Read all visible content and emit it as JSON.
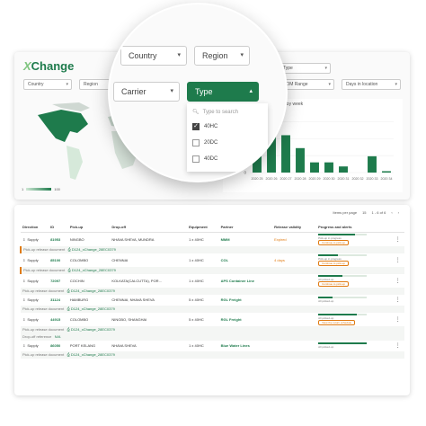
{
  "brand": {
    "x": "X",
    "name": "Change"
  },
  "filters_top_row": [
    "Type"
  ],
  "filters_row2": [
    "Country",
    "Region",
    "YOM Range",
    "Days in location"
  ],
  "magnifier": {
    "country": "Country",
    "region": "Region",
    "carrier": "Carrier",
    "type": "Type",
    "search_placeholder": "Type to search",
    "options": [
      {
        "label": "40HC",
        "checked": true
      },
      {
        "label": "20DC",
        "checked": false
      },
      {
        "label": "40DC",
        "checked": false
      }
    ]
  },
  "map": {
    "legend_min": "1",
    "legend_max": "100"
  },
  "chart_data": {
    "type": "bar",
    "title": "ainers arriving by week",
    "categories": [
      "2020 25",
      "2020 26",
      "2020 27",
      "2020 28",
      "2020 29",
      "2020 30",
      "2020 31",
      "2020 32",
      "2020 33",
      "2020 34"
    ],
    "values": [
      24,
      80,
      55,
      36,
      15,
      15,
      9,
      0,
      24,
      2
    ],
    "yticks": [
      "0",
      "25",
      "50",
      "75"
    ],
    "ylim": [
      0,
      90
    ],
    "color": "#1e7b4c"
  },
  "table": {
    "pager": {
      "items_label": "Items per page",
      "per_page": "15",
      "range": "1 - 6 of 6"
    },
    "columns": [
      "Direction",
      "ID",
      "Pick-up",
      "Drop-off",
      "Equipment",
      "Partner",
      "Release validity",
      "Progress and alerts"
    ],
    "rows": [
      {
        "dir": "Supply",
        "id": "81953",
        "pickup": "NINGBO",
        "dropoff": "NHAVA SHEVA, MUNDRA",
        "equip": "1 x 40HC",
        "partner": "MMM",
        "validity": "",
        "progress": 0.75,
        "ptxt": "Pick-up in progress",
        "sub": "Pick-up release document",
        "doc": "D124_xChange_28EC0379",
        "pill": "Continue to pick-up",
        "sub_validity": "Expired"
      },
      {
        "dir": "Supply",
        "id": "85100",
        "pickup": "COLOMBO",
        "dropoff": "CHENNAI",
        "equip": "1 x 40HC",
        "partner": "COL",
        "validity": "",
        "progress": 0.4,
        "ptxt": "Pick-up in progress",
        "sub": "Pick-up release document",
        "doc": "D124_xChange_28EC0379",
        "pill": "Continue to pick-up",
        "sub_validity": "4 days"
      },
      {
        "dir": "Supply",
        "id": "72097",
        "pickup": "COCHIN",
        "dropoff": "KOLKATA(CALCUTTA), POR...",
        "equip": "1 x 40HC",
        "partner": "APS Container Line",
        "validity": "",
        "progress": 0.5,
        "ptxt": "All picked-up",
        "sub": "Pick-up release document",
        "doc": "D124_xChange_28EC0379",
        "pill": "Continue to pick-up",
        "sub_validity": ""
      },
      {
        "dir": "Supply",
        "id": "31124",
        "pickup": "HAMBURG",
        "dropoff": "CHENNAI, NHAVA SHEVA",
        "equip": "5 x 40HC",
        "partner": "RGL Freight",
        "validity": "",
        "progress": 0.3,
        "ptxt": "All picked-up",
        "sub": "Pick-up release document",
        "doc": "D124_xChange_28EC0379",
        "pill": "",
        "sub_validity": ""
      },
      {
        "dir": "Supply",
        "id": "44915",
        "pickup": "COLOMBO",
        "dropoff": "NINGBO, SHANGHAI",
        "equip": "5 x 40HC",
        "partner": "RGL Freight",
        "validity": "",
        "progress": 0.8,
        "ptxt": "All picked-up",
        "sub": "Pick-up release document",
        "doc": "D124_xChange_28EC0379",
        "sub2": "Drop-off reference",
        "doc2": "N/A",
        "pill": "View the return schedule",
        "sub_validity": ""
      },
      {
        "dir": "Supply",
        "id": "86050",
        "pickup": "PORT KELANG",
        "dropoff": "NHAVA SHEVA",
        "equip": "1 x 40HC",
        "partner": "Blue Water Lines",
        "validity": "",
        "progress": 1.0,
        "ptxt": "All picked-up",
        "sub": "Pick-up release document",
        "doc": "D124_xChange_28EC0379",
        "pill": "",
        "sub_validity": ""
      }
    ]
  }
}
